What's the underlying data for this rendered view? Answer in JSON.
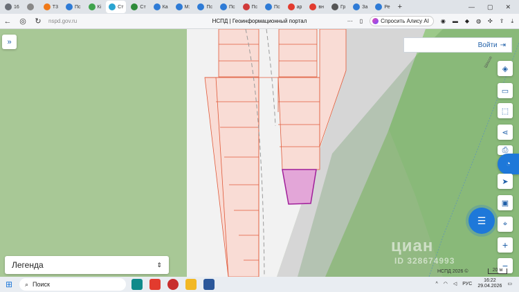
{
  "browser": {
    "tabs": [
      {
        "label": "16",
        "color": "#6a6f77"
      },
      {
        "label": "",
        "color": "#888"
      },
      {
        "label": "Т3",
        "color": "#f07a1a"
      },
      {
        "label": "Пс",
        "color": "#2e7bd6"
      },
      {
        "label": "Кі",
        "color": "#3fa34d"
      },
      {
        "label": "Ст",
        "color": "#2aa4d1"
      },
      {
        "label": "Ст",
        "color": "#2e8b3a"
      },
      {
        "label": "Ка",
        "color": "#2e7bd6"
      },
      {
        "label": "М:",
        "color": "#2e7bd6"
      },
      {
        "label": "Пс",
        "color": "#2e7bd6"
      },
      {
        "label": "Пс",
        "color": "#2e7bd6"
      },
      {
        "label": "Пс",
        "color": "#d03a3a"
      },
      {
        "label": "Пс",
        "color": "#2e7bd6"
      },
      {
        "label": "ар",
        "color": "#e23b2e"
      },
      {
        "label": "вн",
        "color": "#e23b2e"
      },
      {
        "label": "Гр",
        "color": "#555"
      },
      {
        "label": "За",
        "color": "#2e7bd6"
      },
      {
        "label": "Ре",
        "color": "#2e7bd6"
      }
    ],
    "new_tab": "+",
    "url": "nspd.gov.ru",
    "page_title": "НСПД | Геоинформационный портал",
    "alice_label": "Спросить Алису AI"
  },
  "map": {
    "login_label": "Войти",
    "legend_label": "Легенда",
    "watermark": "циан",
    "watermark_id": "ID 328674993",
    "attribution": "НСПД 2026 ©",
    "scale_label": "20 м",
    "road_label": "Шоссе",
    "colors": {
      "forest": "#a8c896",
      "parcel_fill": "#f9dcd5",
      "parcel_border": "#e05a3a",
      "selected_fill": "#e3a6d8",
      "selected_border": "#a01f9a",
      "accent": "#1e78d9"
    }
  },
  "taskbar": {
    "search_placeholder": "Поиск",
    "language": "РУС",
    "time": "16:22",
    "date": "29.04.2026"
  }
}
